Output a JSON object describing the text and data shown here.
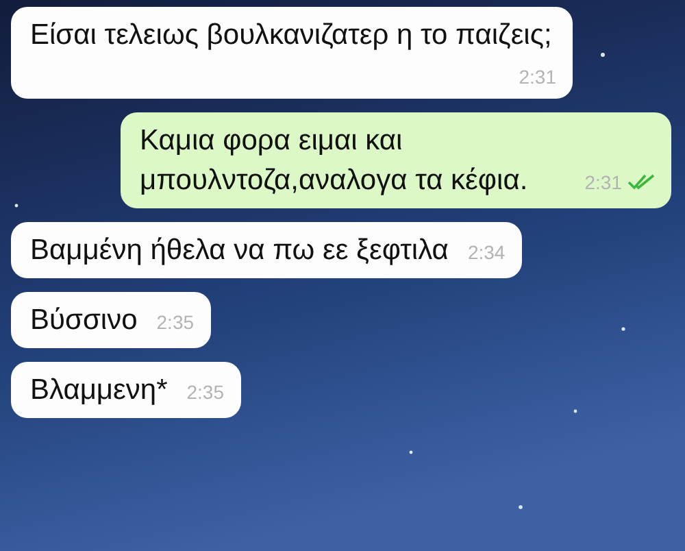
{
  "messages": [
    {
      "kind": "incoming",
      "text": "Είσαι τελειως βουλκανιζατερ η το παιζεις;",
      "time": "2:31"
    },
    {
      "kind": "outgoing",
      "text": "Καμια φορα ειμαι και μπουλντοζα,αναλογα τα κέφια.",
      "time": "2:31",
      "read": true
    },
    {
      "kind": "incoming",
      "text": "Βαμμένη ήθελα να πω εε ξεφτιλα",
      "time": "2:34"
    },
    {
      "kind": "incoming",
      "text": "Βύσσινο",
      "time": "2:35"
    },
    {
      "kind": "incoming",
      "text": "Βλαμμενη*",
      "time": "2:35"
    }
  ]
}
